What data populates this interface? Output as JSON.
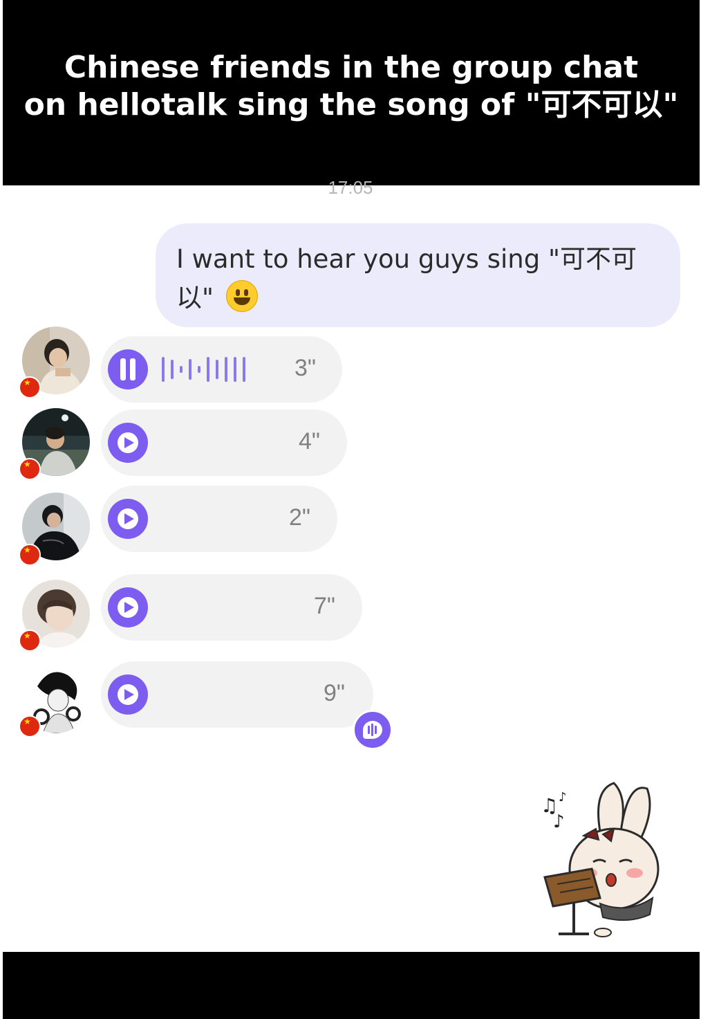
{
  "caption": {
    "line1": "Chinese friends in the group chat",
    "line2": "on hellotalk sing the song of \"可不可以\""
  },
  "chat": {
    "timestamp": "17:05",
    "outgoing_message": "I want to hear you guys sing \"可不可以\"",
    "voice_messages": [
      {
        "duration": "3\"",
        "state": "playing"
      },
      {
        "duration": "4\"",
        "state": "paused"
      },
      {
        "duration": "2\"",
        "state": "paused"
      },
      {
        "duration": "7\"",
        "state": "paused"
      },
      {
        "duration": "9\"",
        "state": "paused"
      }
    ]
  },
  "icons": {
    "pause": "pause-icon",
    "play": "play-icon",
    "flag": "china-flag-icon",
    "transcribe": "voice-to-text-icon",
    "emoji": "smiley-emoji-icon",
    "sticker": "singing-bunny-sticker"
  },
  "colors": {
    "accent": "#7d5cf0",
    "outgoing_bubble": "#ecebfb",
    "incoming_bubble": "#f2f2f2"
  }
}
